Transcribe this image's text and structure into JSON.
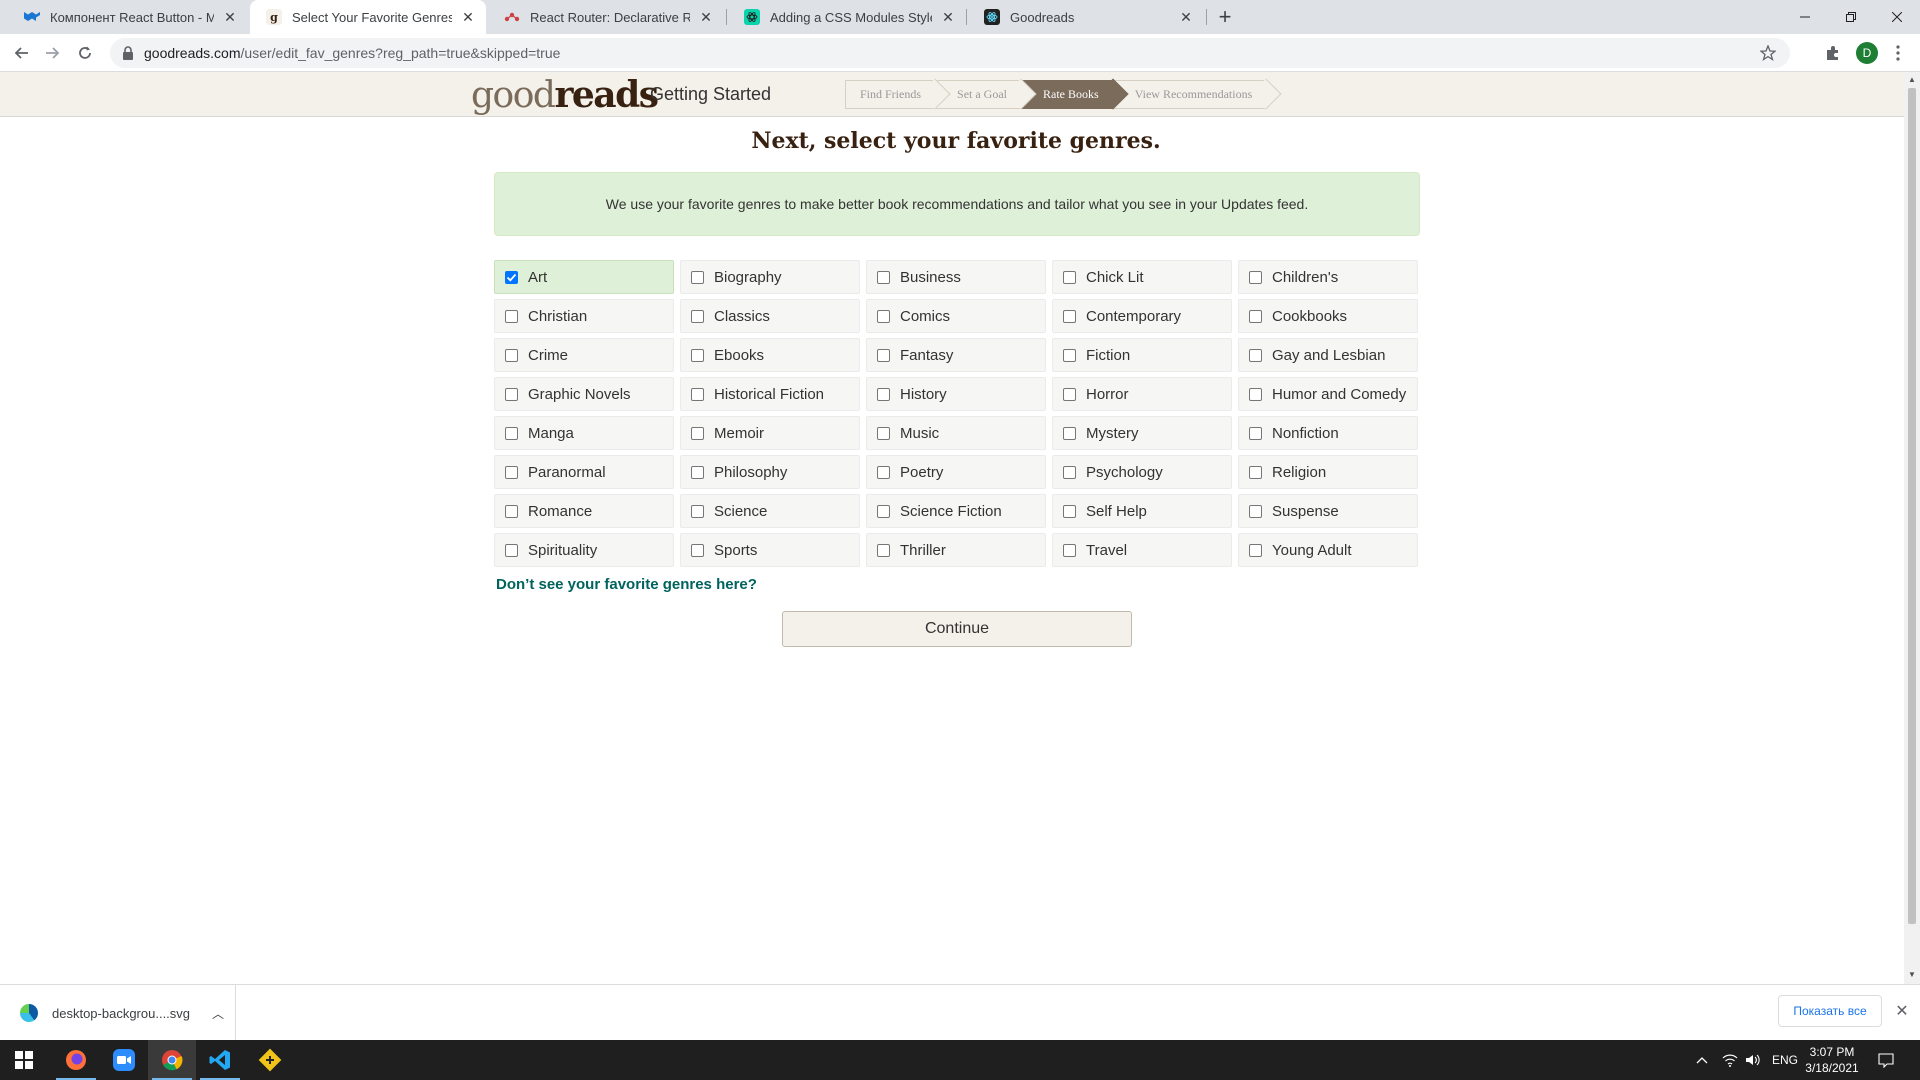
{
  "browser": {
    "tabs": [
      {
        "title": "Компонент React Button - Materi",
        "favicon": "material-ui-icon",
        "active": false
      },
      {
        "title": "Select Your Favorite Genres | Goo",
        "favicon": "goodreads-g-icon",
        "active": true
      },
      {
        "title": "React Router: Declarative Routing",
        "favicon": "react-router-icon",
        "active": false
      },
      {
        "title": "Adding a CSS Modules Styleshee",
        "favicon": "create-react-app-icon",
        "active": false
      },
      {
        "title": "Goodreads",
        "favicon": "react-icon",
        "active": false
      }
    ],
    "url_host": "goodreads.com",
    "url_path": "/user/edit_fav_genres?reg_path=true&skipped=true",
    "profile_initial": "D"
  },
  "header": {
    "logo_light": "good",
    "logo_bold": "reads",
    "getting_started": "Getting Started",
    "steps": [
      {
        "label": "Find Friends",
        "active": false
      },
      {
        "label": "Set a Goal",
        "active": false
      },
      {
        "label": "Rate Books",
        "active": true
      },
      {
        "label": "View Recommendations",
        "active": false
      }
    ]
  },
  "main": {
    "heading": "Next, select your favorite genres.",
    "notice": "We use your favorite genres to make better book recommendations and tailor what you see in your Updates feed.",
    "genres": [
      {
        "label": "Art",
        "checked": true
      },
      {
        "label": "Biography",
        "checked": false
      },
      {
        "label": "Business",
        "checked": false
      },
      {
        "label": "Chick Lit",
        "checked": false
      },
      {
        "label": "Children's",
        "checked": false
      },
      {
        "label": "Christian",
        "checked": false
      },
      {
        "label": "Classics",
        "checked": false
      },
      {
        "label": "Comics",
        "checked": false
      },
      {
        "label": "Contemporary",
        "checked": false
      },
      {
        "label": "Cookbooks",
        "checked": false
      },
      {
        "label": "Crime",
        "checked": false
      },
      {
        "label": "Ebooks",
        "checked": false
      },
      {
        "label": "Fantasy",
        "checked": false
      },
      {
        "label": "Fiction",
        "checked": false
      },
      {
        "label": "Gay and Lesbian",
        "checked": false
      },
      {
        "label": "Graphic Novels",
        "checked": false
      },
      {
        "label": "Historical Fiction",
        "checked": false
      },
      {
        "label": "History",
        "checked": false
      },
      {
        "label": "Horror",
        "checked": false
      },
      {
        "label": "Humor and Comedy",
        "checked": false
      },
      {
        "label": "Manga",
        "checked": false
      },
      {
        "label": "Memoir",
        "checked": false
      },
      {
        "label": "Music",
        "checked": false
      },
      {
        "label": "Mystery",
        "checked": false
      },
      {
        "label": "Nonfiction",
        "checked": false
      },
      {
        "label": "Paranormal",
        "checked": false
      },
      {
        "label": "Philosophy",
        "checked": false
      },
      {
        "label": "Poetry",
        "checked": false
      },
      {
        "label": "Psychology",
        "checked": false
      },
      {
        "label": "Religion",
        "checked": false
      },
      {
        "label": "Romance",
        "checked": false
      },
      {
        "label": "Science",
        "checked": false
      },
      {
        "label": "Science Fiction",
        "checked": false
      },
      {
        "label": "Self Help",
        "checked": false
      },
      {
        "label": "Suspense",
        "checked": false
      },
      {
        "label": "Spirituality",
        "checked": false
      },
      {
        "label": "Sports",
        "checked": false
      },
      {
        "label": "Thriller",
        "checked": false
      },
      {
        "label": "Travel",
        "checked": false
      },
      {
        "label": "Young Adult",
        "checked": false
      }
    ],
    "dont_see": "Don’t see your favorite genres here?",
    "continue_label": "Continue"
  },
  "download_bar": {
    "file_name": "desktop-backgrou....svg",
    "show_all": "Показать все"
  },
  "taskbar": {
    "apps": [
      "firefox-icon",
      "zoom-icon",
      "chrome-icon",
      "vscode-icon",
      "git-gui-icon"
    ],
    "language": "ENG",
    "time": "3:07 PM",
    "date": "3/18/2021"
  },
  "colors": {
    "goodreads_brown": "#382110",
    "header_bg": "#f4f1ea",
    "notice_bg": "#dff0d8",
    "link_teal": "#00635d",
    "checkbox_blue": "#0075ff"
  }
}
